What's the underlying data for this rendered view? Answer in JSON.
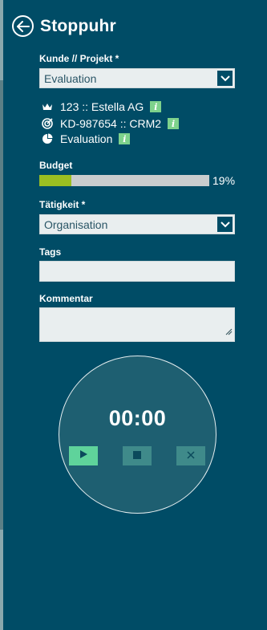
{
  "header": {
    "title": "Stoppuhr",
    "back_icon": "arrow-left-circle-icon"
  },
  "customer_project": {
    "label": "Kunde // Projekt *",
    "selected": "Evaluation"
  },
  "info": {
    "customer": {
      "icon": "crown-icon",
      "text": "123 :: Estella AG"
    },
    "project": {
      "icon": "target-icon",
      "text": "KD-987654 :: CRM2"
    },
    "activity": {
      "icon": "pie-chart-icon",
      "text": "Evaluation"
    },
    "info_badge": "i"
  },
  "budget": {
    "label": "Budget",
    "percent": 19,
    "percent_label": "19%",
    "color": "#9bbf22"
  },
  "activity_select": {
    "label": "Tätigkeit *",
    "selected": "Organisation"
  },
  "tags": {
    "label": "Tags",
    "value": ""
  },
  "comment": {
    "label": "Kommentar",
    "value": ""
  },
  "timer": {
    "display": "00:00",
    "buttons": [
      "play-icon",
      "stop-icon",
      "close-icon"
    ]
  },
  "colors": {
    "background": "#004c66",
    "accent": "#5fd39b",
    "badge": "#7ed28c"
  }
}
